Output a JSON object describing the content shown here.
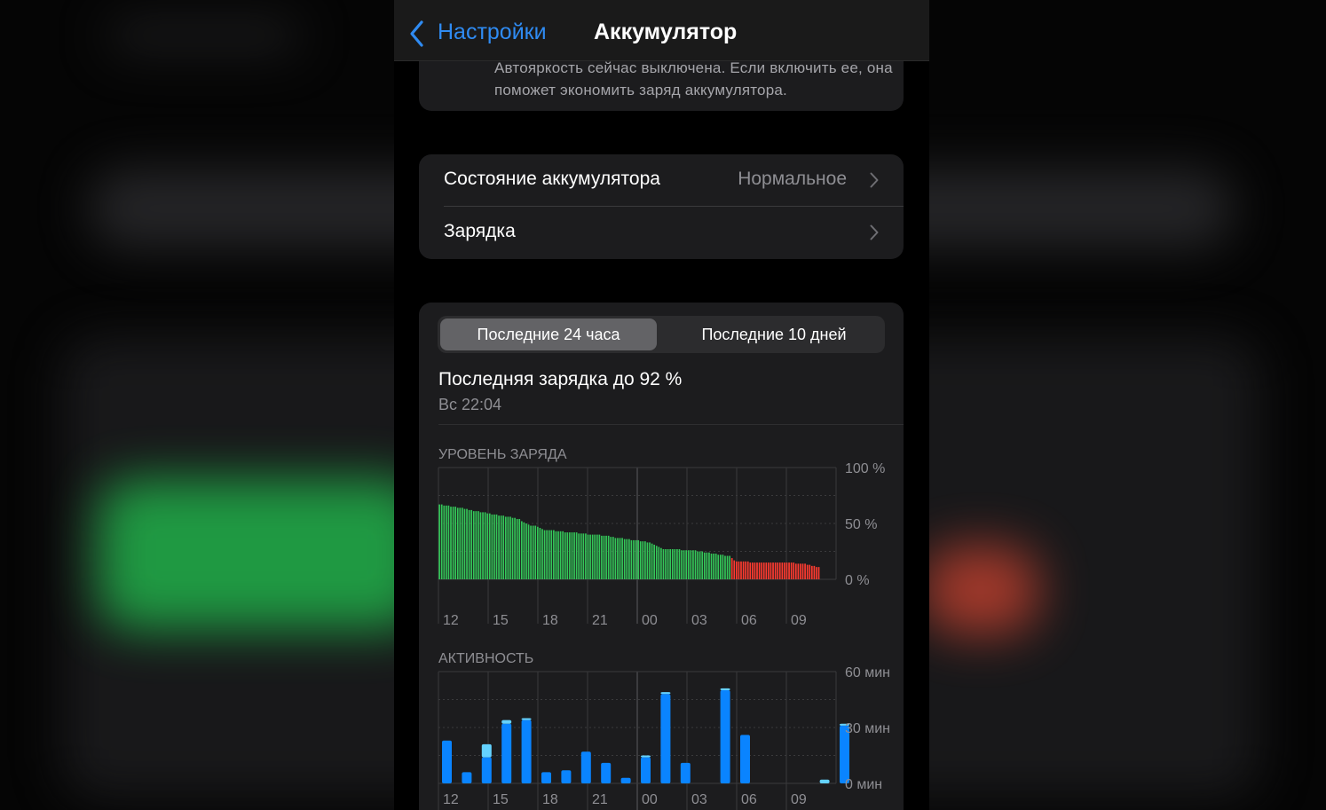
{
  "nav": {
    "back_label": "Настройки",
    "title": "Аккумулятор"
  },
  "auto_brightness": {
    "text": "Автояркость сейчас выключена. Если включить ее, она поможет экономить заряд аккумулятора."
  },
  "list": {
    "items": [
      {
        "label": "Состояние аккумулятора",
        "value": "Нормальное"
      },
      {
        "label": "Зарядка",
        "value": ""
      }
    ]
  },
  "usage": {
    "tabs": [
      "Последние 24 часа",
      "Последние 10 дней"
    ],
    "selected_tab": 0,
    "last_charge": "Последняя зарядка до 92 %",
    "last_charge_time": "Вс 22:04"
  },
  "colors": {
    "accent": "#2f8bf2",
    "battery_ok": "#34c759",
    "battery_low": "#ff3b30",
    "activity_screen_on": "#0a84ff",
    "activity_screen_off": "#64d2ff"
  },
  "chart_data": [
    {
      "type": "bar",
      "title": "УРОВЕНЬ ЗАРЯДА",
      "x_ticks": [
        "12",
        "15",
        "18",
        "21",
        "00",
        "03",
        "06",
        "09"
      ],
      "y_ticks": [
        "100 %",
        "50 %",
        "0 %"
      ],
      "ylim": [
        0,
        100
      ],
      "grid": true,
      "low_threshold": 20,
      "values": [
        67,
        67,
        66,
        66,
        66,
        65,
        65,
        65,
        64,
        64,
        64,
        63,
        63,
        62,
        62,
        61,
        61,
        61,
        60,
        60,
        60,
        59,
        59,
        58,
        58,
        58,
        57,
        57,
        57,
        56,
        56,
        56,
        55,
        55,
        54,
        54,
        52,
        51,
        50,
        49,
        48,
        48,
        48,
        47,
        46,
        45,
        44,
        44,
        44,
        44,
        44,
        43,
        43,
        43,
        43,
        42,
        42,
        42,
        42,
        42,
        42,
        41,
        41,
        41,
        41,
        40,
        40,
        40,
        40,
        40,
        40,
        39,
        39,
        39,
        39,
        38,
        38,
        37,
        37,
        37,
        37,
        36,
        36,
        36,
        35,
        35,
        35,
        35,
        34,
        34,
        34,
        33,
        33,
        32,
        31,
        30,
        29,
        28,
        27,
        27,
        27,
        27,
        27,
        27,
        27,
        27,
        26,
        26,
        26,
        26,
        26,
        26,
        26,
        25,
        25,
        25,
        24,
        24,
        24,
        23,
        23,
        23,
        22,
        22,
        22,
        21,
        21,
        21,
        19,
        17,
        16,
        16,
        16,
        16,
        16,
        16,
        15,
        15,
        15,
        15,
        15,
        15,
        15,
        15,
        15,
        15,
        15,
        15,
        15,
        15,
        15,
        15,
        15,
        15,
        15,
        15,
        14,
        14,
        14,
        14,
        14,
        13,
        13,
        12,
        12,
        11,
        11
      ]
    },
    {
      "type": "bar",
      "title": "АКТИВНОСТЬ",
      "x_ticks": [
        "12",
        "15",
        "18",
        "21",
        "00",
        "03",
        "06",
        "09"
      ],
      "y_ticks": [
        "60 мин",
        "30 мин",
        "0 мин"
      ],
      "ylim": [
        0,
        60
      ],
      "grid": true,
      "series": [
        {
          "name": "screen_on",
          "values": [
            23,
            6,
            14,
            32,
            34,
            6,
            7,
            17,
            11,
            3,
            14,
            48,
            11,
            0,
            50,
            26,
            0,
            0,
            0,
            0,
            31
          ]
        },
        {
          "name": "screen_off",
          "values": [
            0,
            0,
            7,
            2,
            1,
            0,
            0,
            0,
            0,
            0,
            1,
            1,
            0,
            0,
            1,
            0,
            0,
            0,
            0,
            2,
            1
          ]
        }
      ]
    }
  ]
}
